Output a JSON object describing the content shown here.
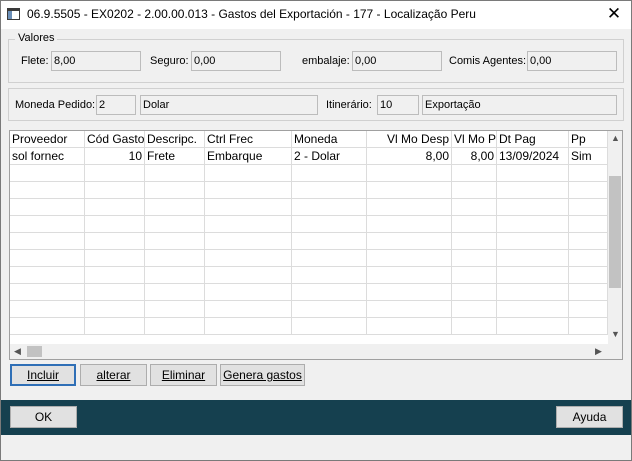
{
  "window": {
    "title": "06.9.5505 - EX0202 - 2.00.00.013 - Gastos del Exportación - 177 - Localização Peru",
    "close_glyph": "✕"
  },
  "valores": {
    "group_label": "Valores",
    "flete": {
      "label": "Flete:",
      "value": "8,00"
    },
    "seguro": {
      "label": "Seguro:",
      "value": "0,00"
    },
    "embalaje": {
      "label": "embalaje:",
      "value": "0,00"
    },
    "comis_agentes": {
      "label": "Comis Agentes:",
      "value": "0,00"
    }
  },
  "pedido": {
    "moneda": {
      "label": "Moneda Pedido:",
      "code": "2",
      "name": "Dolar"
    },
    "itinerario": {
      "label": "Itinerário:",
      "code": "10",
      "name": "Exportação"
    }
  },
  "grid": {
    "columns": [
      "Proveedor",
      "Cód Gasto",
      "Descripc.",
      "Ctrl Frec",
      "Moneda",
      "Vl Mo Desp",
      "Vl Mo Ped",
      "Dt Pag",
      "Pp"
    ],
    "rows": [
      [
        "sol fornec",
        "10",
        "Frete",
        "Embarque",
        "2 - Dolar",
        "8,00",
        "8,00",
        "13/09/2024",
        "Sim"
      ]
    ]
  },
  "actions": {
    "incluir": "Incluir",
    "alterar": "alterar",
    "eliminar": "Eliminar",
    "genera_gastos": "Genera gastos"
  },
  "footer": {
    "ok": "OK",
    "ayuda": "Ayuda"
  }
}
